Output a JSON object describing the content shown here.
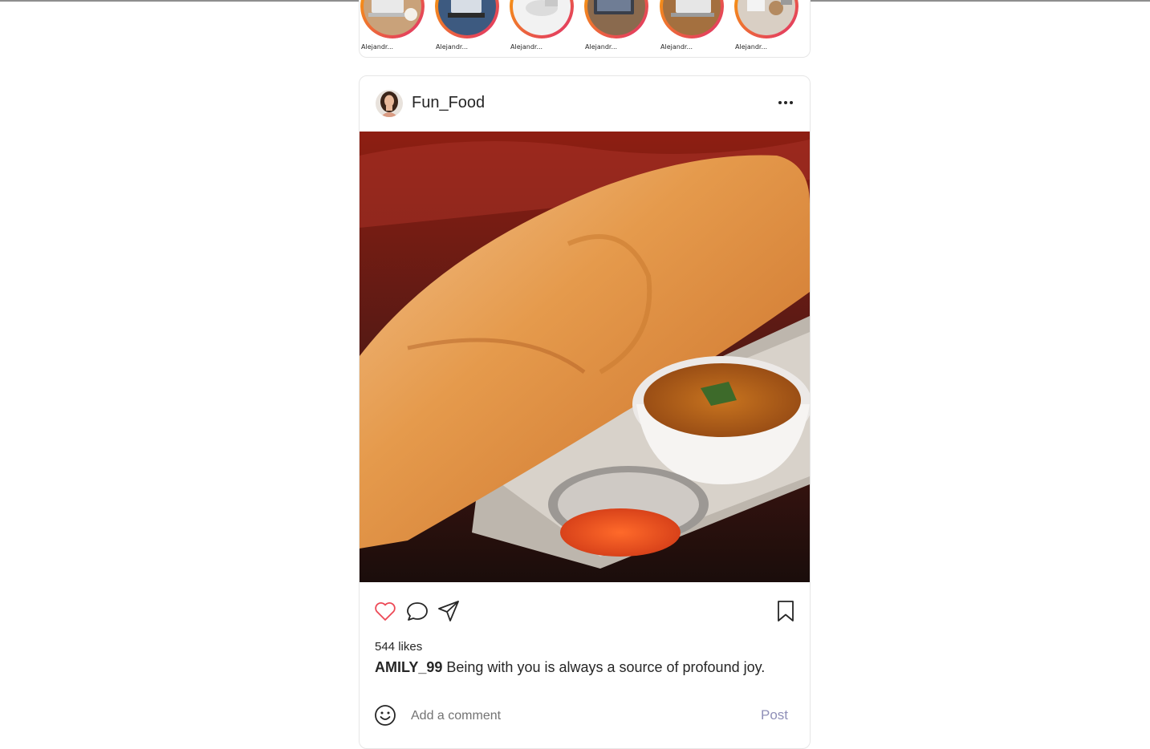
{
  "stories": [
    {
      "label": "Alejandr...",
      "icon": "laptop-thumb"
    },
    {
      "label": "Alejandr...",
      "icon": "laptop-thumb"
    },
    {
      "label": "Alejandr...",
      "icon": "laptop-thumb"
    },
    {
      "label": "Alejandr...",
      "icon": "laptop-thumb"
    },
    {
      "label": "Alejandr...",
      "icon": "laptop-thumb"
    },
    {
      "label": "Alejandr...",
      "icon": "laptop-thumb"
    }
  ],
  "post": {
    "username": "Fun_Food",
    "likes": "544 likes",
    "caption_user": "AMILY_99",
    "caption_text": "Being with you is always a source of profound joy.",
    "comment_placeholder": "Add a comment",
    "post_label": "Post"
  },
  "colors": {
    "like_icon": "#ed4956",
    "story_ring_start": "#f9a602",
    "story_ring_end": "#e1306c",
    "post_button": "#8f8fb8"
  }
}
